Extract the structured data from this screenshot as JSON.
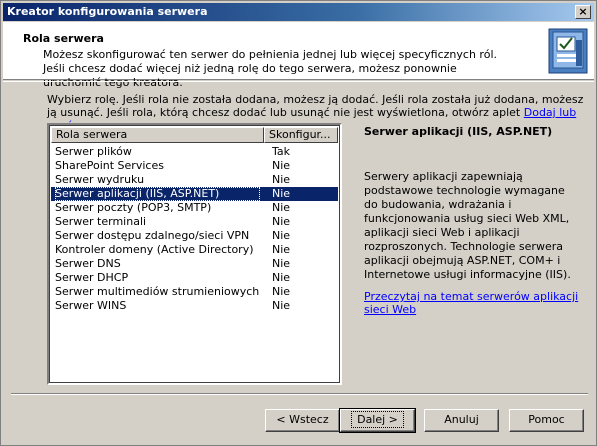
{
  "window": {
    "title": "Kreator konfigurowania serwera",
    "close_glyph": "×"
  },
  "header": {
    "title": "Rola serwera",
    "description": "Możesz skonfigurować ten serwer do pełnienia jednej lub więcej specyficznych ról. Jeśli chcesz dodać więcej niż jedną rolę do tego serwera, możesz ponownie uruchomić tego kreatora.",
    "icon": "server-config-icon"
  },
  "instructions": {
    "text": "Wybierz rolę. Jeśli rola nie została dodana, możesz ją dodać. Jeśli rola została już dodana, możesz ją usunąć. Jeśli rola, którą chcesz dodać lub usunąć nie jest wyświetlona, otwórz aplet ",
    "link": "Dodaj lub usuń programy",
    "suffix": "."
  },
  "roles_list": {
    "columns": [
      "Rola serwera",
      "Skonfigur..."
    ],
    "rows": [
      {
        "name": "Serwer plików",
        "configured": "Tak"
      },
      {
        "name": "SharePoint Services",
        "configured": "Nie"
      },
      {
        "name": "Serwer wydruku",
        "configured": "Nie"
      },
      {
        "name": "Serwer aplikacji (IIS, ASP.NET)",
        "configured": "Nie"
      },
      {
        "name": "Serwer poczty (POP3, SMTP)",
        "configured": "Nie"
      },
      {
        "name": "Serwer terminali",
        "configured": "Nie"
      },
      {
        "name": "Serwer dostępu zdalnego/sieci VPN",
        "configured": "Nie"
      },
      {
        "name": "Kontroler domeny (Active Directory)",
        "configured": "Nie"
      },
      {
        "name": "Serwer DNS",
        "configured": "Nie"
      },
      {
        "name": "Serwer DHCP",
        "configured": "Nie"
      },
      {
        "name": "Serwer multimediów strumieniowych",
        "configured": "Nie"
      },
      {
        "name": "Serwer WINS",
        "configured": "Nie"
      }
    ],
    "selected_row": "Serwer aplikacji (IIS, ASP.NET)"
  },
  "details": {
    "title": "Serwer aplikacji (IIS, ASP.NET)",
    "text": "Serwery aplikacji zapewniają podstawowe technologie wymagane do budowania, wdrażania i funkcjonowania usług sieci Web XML, aplikacji sieci Web i aplikacji rozproszonych. Technologie serwera aplikacji obejmują ASP.NET, COM+ i Internetowe usługi informacyjne (IIS).",
    "link": "Przeczytaj na temat serwerów aplikacji sieci Web"
  },
  "buttons": {
    "back": "< Wstecz",
    "next": "Dalej >",
    "cancel": "Anuluj",
    "help": "Pomoc"
  }
}
